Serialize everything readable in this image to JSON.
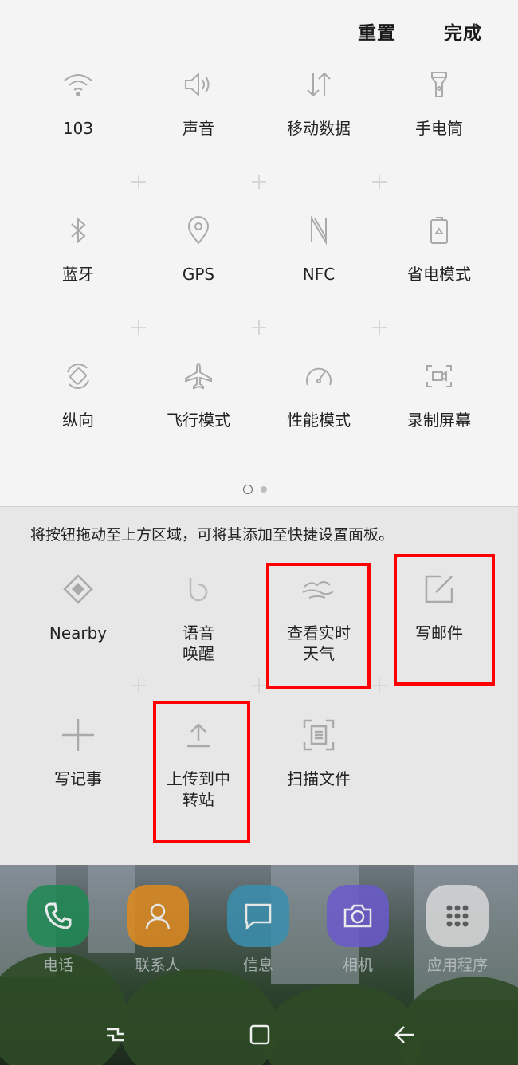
{
  "header": {
    "reset_label": "重置",
    "done_label": "完成"
  },
  "active_tiles": [
    {
      "label": "103",
      "icon": "wifi-icon"
    },
    {
      "label": "声音",
      "icon": "sound-icon"
    },
    {
      "label": "移动数据",
      "icon": "mobile-data-icon"
    },
    {
      "label": "手电筒",
      "icon": "flashlight-icon"
    },
    {
      "label": "蓝牙",
      "icon": "bluetooth-icon"
    },
    {
      "label": "GPS",
      "icon": "location-icon"
    },
    {
      "label": "NFC",
      "icon": "nfc-icon"
    },
    {
      "label": "省电模式",
      "icon": "power-saving-icon"
    },
    {
      "label": "纵向",
      "icon": "rotation-icon"
    },
    {
      "label": "飞行模式",
      "icon": "airplane-icon"
    },
    {
      "label": "性能模式",
      "icon": "performance-icon"
    },
    {
      "label": "录制屏幕",
      "icon": "screen-record-icon"
    }
  ],
  "pagination": {
    "pages": 2,
    "current": 1
  },
  "hint": "将按钮拖动至上方区域，可将其添加至快捷设置面板。",
  "available_tiles": [
    {
      "label_line1": "Nearby",
      "label_line2": "",
      "icon": "nearby-icon"
    },
    {
      "label_line1": "语音",
      "label_line2": "唤醒",
      "icon": "bixby-icon"
    },
    {
      "label_line1": "查看实时",
      "label_line2": "天气",
      "icon": "weather-icon"
    },
    {
      "label_line1": "写邮件",
      "label_line2": "",
      "icon": "compose-icon"
    },
    {
      "label_line1": "写记事",
      "label_line2": "",
      "icon": "add-note-icon"
    },
    {
      "label_line1": "上传到中",
      "label_line2": "转站",
      "icon": "upload-icon"
    },
    {
      "label_line1": "扫描文件",
      "label_line2": "",
      "icon": "scan-icon"
    }
  ],
  "dock": [
    {
      "label": "电话",
      "icon": "phone-icon",
      "color": "#1f8a55"
    },
    {
      "label": "联系人",
      "icon": "contacts-icon",
      "color": "#e08a1e"
    },
    {
      "label": "信息",
      "icon": "message-icon",
      "color": "#3a8fb0"
    },
    {
      "label": "相机",
      "icon": "camera-icon",
      "color": "#6a5acd"
    },
    {
      "label": "应用程序",
      "icon": "apps-icon",
      "color": "#d8d8d8"
    }
  ],
  "highlight_color": "#ff0000"
}
